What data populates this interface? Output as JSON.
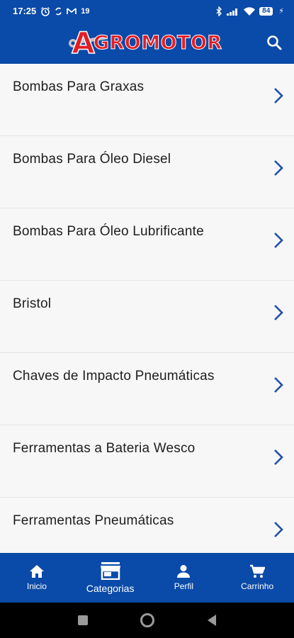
{
  "status_bar": {
    "time": "17:25",
    "battery": "84",
    "signal_label": "19"
  },
  "app_bar": {
    "logo_initial": "A",
    "logo_rest": "GROMOTOR",
    "brand_color": "#0a4aa8",
    "logo_color": "#e21d24",
    "search_icon": "search-icon"
  },
  "categories": [
    {
      "label": "Bombas Para Graxas"
    },
    {
      "label": "Bombas Para Óleo Diesel"
    },
    {
      "label": "Bombas Para Óleo Lubrificante"
    },
    {
      "label": "Bristol"
    },
    {
      "label": "Chaves de Impacto Pneumáticas"
    },
    {
      "label": "Ferramentas a Bateria Wesco"
    },
    {
      "label": "Ferramentas Pneumáticas"
    }
  ],
  "bottom_nav": {
    "items": [
      {
        "label": "Inicio",
        "icon": "home-icon"
      },
      {
        "label": "Categorias",
        "icon": "store-icon",
        "active": true
      },
      {
        "label": "Perfil",
        "icon": "person-icon"
      },
      {
        "label": "Carrinho",
        "icon": "cart-icon"
      }
    ]
  },
  "system_nav": {
    "icons": [
      "recents-icon",
      "home-circle-icon",
      "back-icon"
    ]
  }
}
